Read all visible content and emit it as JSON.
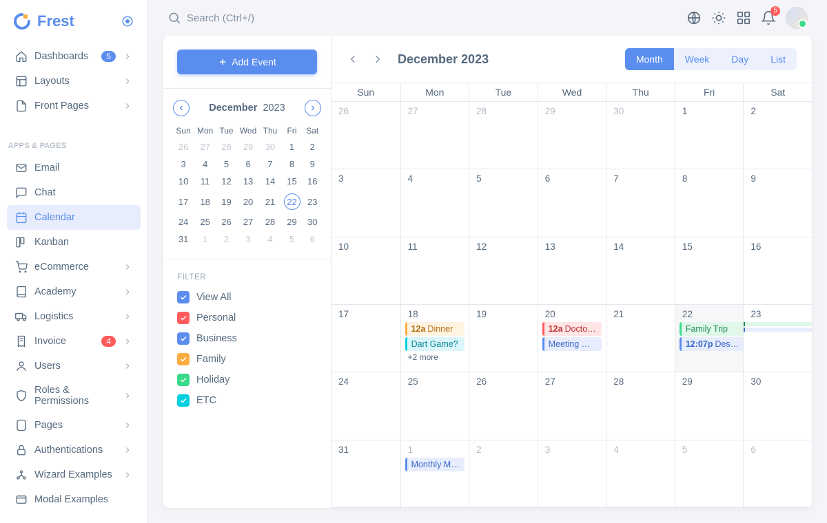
{
  "brand": "Frest",
  "search_placeholder": "Search (Ctrl+/)",
  "notif_count": "5",
  "nav_top": [
    {
      "label": "Dashboards",
      "icon": "home",
      "badge": "5",
      "badge_color": "blue",
      "chev": true
    },
    {
      "label": "Layouts",
      "icon": "layout",
      "chev": true
    },
    {
      "label": "Front Pages",
      "icon": "file",
      "chev": true
    }
  ],
  "section_label": "APPS & PAGES",
  "nav_apps": [
    {
      "label": "Email",
      "icon": "mail"
    },
    {
      "label": "Chat",
      "icon": "chat"
    },
    {
      "label": "Calendar",
      "icon": "calendar",
      "active": true
    },
    {
      "label": "Kanban",
      "icon": "kanban"
    },
    {
      "label": "eCommerce",
      "icon": "cart",
      "chev": true
    },
    {
      "label": "Academy",
      "icon": "book",
      "chev": true
    },
    {
      "label": "Logistics",
      "icon": "truck",
      "chev": true
    },
    {
      "label": "Invoice",
      "icon": "receipt",
      "badge": "4",
      "badge_color": "red",
      "chev": true
    },
    {
      "label": "Users",
      "icon": "user",
      "chev": true
    },
    {
      "label": "Roles & Permissions",
      "icon": "shield",
      "chev": true
    },
    {
      "label": "Pages",
      "icon": "pages",
      "chev": true
    },
    {
      "label": "Authentications",
      "icon": "lock",
      "chev": true
    },
    {
      "label": "Wizard Examples",
      "icon": "wizard",
      "chev": true
    },
    {
      "label": "Modal Examples",
      "icon": "modal"
    }
  ],
  "add_event_label": "Add Event",
  "mini_cal": {
    "month": "December",
    "year": "2023",
    "dow": [
      "Sun",
      "Mon",
      "Tue",
      "Wed",
      "Thu",
      "Fri",
      "Sat"
    ],
    "weeks": [
      [
        {
          "n": "26",
          "o": 1
        },
        {
          "n": "27",
          "o": 1
        },
        {
          "n": "28",
          "o": 1
        },
        {
          "n": "29",
          "o": 1
        },
        {
          "n": "30",
          "o": 1
        },
        {
          "n": "1"
        },
        {
          "n": "2"
        }
      ],
      [
        {
          "n": "3"
        },
        {
          "n": "4"
        },
        {
          "n": "5"
        },
        {
          "n": "6"
        },
        {
          "n": "7"
        },
        {
          "n": "8"
        },
        {
          "n": "9"
        }
      ],
      [
        {
          "n": "10"
        },
        {
          "n": "11"
        },
        {
          "n": "12"
        },
        {
          "n": "13"
        },
        {
          "n": "14"
        },
        {
          "n": "15"
        },
        {
          "n": "16"
        }
      ],
      [
        {
          "n": "17"
        },
        {
          "n": "18"
        },
        {
          "n": "19"
        },
        {
          "n": "20"
        },
        {
          "n": "21"
        },
        {
          "n": "22",
          "t": 1
        },
        {
          "n": "23"
        }
      ],
      [
        {
          "n": "24"
        },
        {
          "n": "25"
        },
        {
          "n": "26"
        },
        {
          "n": "27"
        },
        {
          "n": "28"
        },
        {
          "n": "29"
        },
        {
          "n": "30"
        }
      ],
      [
        {
          "n": "31"
        },
        {
          "n": "1",
          "o": 1
        },
        {
          "n": "2",
          "o": 1
        },
        {
          "n": "3",
          "o": 1
        },
        {
          "n": "4",
          "o": 1
        },
        {
          "n": "5",
          "o": 1
        },
        {
          "n": "6",
          "o": 1
        }
      ]
    ]
  },
  "filter_title": "FILTER",
  "filters": [
    {
      "label": "View All",
      "color": "#5a8dee"
    },
    {
      "label": "Personal",
      "color": "#ff5b5c"
    },
    {
      "label": "Business",
      "color": "#5a8dee"
    },
    {
      "label": "Family",
      "color": "#fdac41"
    },
    {
      "label": "Holiday",
      "color": "#39da8a"
    },
    {
      "label": "ETC",
      "color": "#00cfdd"
    }
  ],
  "cal_title": "December 2023",
  "views": [
    {
      "label": "Month",
      "active": true
    },
    {
      "label": "Week"
    },
    {
      "label": "Day"
    },
    {
      "label": "List"
    }
  ],
  "dow_full": [
    "Sun",
    "Mon",
    "Tue",
    "Wed",
    "Thu",
    "Fri",
    "Sat"
  ],
  "weeks": [
    {
      "days": [
        {
          "n": "26",
          "o": 1
        },
        {
          "n": "27",
          "o": 1
        },
        {
          "n": "28",
          "o": 1
        },
        {
          "n": "29",
          "o": 1
        },
        {
          "n": "30",
          "o": 1
        },
        {
          "n": "1"
        },
        {
          "n": "2"
        }
      ]
    },
    {
      "days": [
        {
          "n": "3"
        },
        {
          "n": "4"
        },
        {
          "n": "5"
        },
        {
          "n": "6"
        },
        {
          "n": "7"
        },
        {
          "n": "8"
        },
        {
          "n": "9"
        }
      ]
    },
    {
      "days": [
        {
          "n": "10"
        },
        {
          "n": "11"
        },
        {
          "n": "12"
        },
        {
          "n": "13"
        },
        {
          "n": "14"
        },
        {
          "n": "15"
        },
        {
          "n": "16"
        }
      ]
    },
    {
      "days": [
        {
          "n": "17"
        },
        {
          "n": "18",
          "events": [
            {
              "time": "12a",
              "title": "Dinner",
              "cls": "ev-warning"
            },
            {
              "title": "Dart Game?",
              "cls": "ev-info"
            }
          ],
          "more": "+2 more"
        },
        {
          "n": "19"
        },
        {
          "n": "20",
          "events": [
            {
              "time": "12a",
              "title": "Doctor's Appointment",
              "cls": "ev-danger"
            },
            {
              "title": "Meeting With Client",
              "cls": "ev-primary"
            }
          ]
        },
        {
          "n": "21"
        },
        {
          "n": "22",
          "shade": 1,
          "events": [
            {
              "title": "Family Trip",
              "cls": "ev-success",
              "span": "start"
            },
            {
              "time": "12:07p",
              "title": "Design Review",
              "cls": "ev-primary",
              "span": "start"
            }
          ]
        },
        {
          "n": "23",
          "events": [
            {
              "title": " ",
              "cls": "ev-success",
              "span": "cont"
            },
            {
              "title": " ",
              "cls": "ev-primary",
              "span": "cont"
            }
          ]
        }
      ]
    },
    {
      "days": [
        {
          "n": "24"
        },
        {
          "n": "25"
        },
        {
          "n": "26"
        },
        {
          "n": "27"
        },
        {
          "n": "28"
        },
        {
          "n": "29"
        },
        {
          "n": "30"
        }
      ]
    },
    {
      "days": [
        {
          "n": "31"
        },
        {
          "n": "1",
          "o": 1,
          "events": [
            {
              "title": "Monthly Meeting",
              "cls": "ev-primary"
            }
          ]
        },
        {
          "n": "2",
          "o": 1
        },
        {
          "n": "3",
          "o": 1
        },
        {
          "n": "4",
          "o": 1
        },
        {
          "n": "5",
          "o": 1
        },
        {
          "n": "6",
          "o": 1
        }
      ]
    }
  ]
}
